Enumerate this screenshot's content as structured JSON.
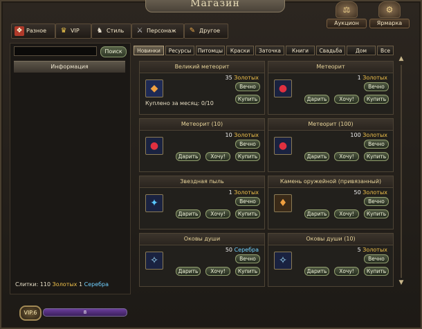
{
  "window": {
    "title": "Магазин"
  },
  "top_buttons": {
    "auction": "Аукцион",
    "fair": "Ярмарка"
  },
  "categories": [
    {
      "label": "Разное",
      "icon": "gift-icon"
    },
    {
      "label": "VIP",
      "icon": "crown-icon"
    },
    {
      "label": "Стиль",
      "icon": "costume-icon"
    },
    {
      "label": "Персонаж",
      "icon": "sword-icon"
    },
    {
      "label": "Другое",
      "icon": "torch-icon"
    }
  ],
  "search": {
    "value": "",
    "button": "Поиск"
  },
  "info_header": "Информация",
  "balance": {
    "label": "Слитки:",
    "gold_amount": "110",
    "gold_unit": "Золотых",
    "silver_amount": "1",
    "silver_unit": "Серебра"
  },
  "tabs": [
    "Новинки",
    "Ресурсы",
    "Питомцы",
    "Краски",
    "Заточка",
    "Книги",
    "Свадьба",
    "Дом",
    "Все"
  ],
  "active_tab": "Новинки",
  "buttons": {
    "forever": "Вечно",
    "buy": "Купить",
    "gift": "Дарить",
    "want": "Хочу!"
  },
  "cards": [
    {
      "title": "Великий метеорит",
      "price": "35",
      "currency": "Золотых",
      "bought": "Куплено за месяц: 0/10"
    },
    {
      "title": "Метеорит",
      "price": "1",
      "currency": "Золотых"
    },
    {
      "title": "Метеорит (10)",
      "price": "10",
      "currency": "Золотых"
    },
    {
      "title": "Метеорит (100)",
      "price": "100",
      "currency": "Золотых"
    },
    {
      "title": "Звездная пыль",
      "price": "1",
      "currency": "Золотых"
    },
    {
      "title": "Камень оружейной (привязанный)",
      "price": "50",
      "currency": "Золотых"
    },
    {
      "title": "Оковы души",
      "price": "50",
      "currency": "Серебра"
    },
    {
      "title": "Оковы души (10)",
      "price": "5",
      "currency": "Золотых"
    }
  ],
  "vip": {
    "label": "VIP.6",
    "level": "8"
  },
  "colors": {
    "gold": "#f0c14a",
    "silver": "#6fd0ff",
    "title_text": "#e8d49a"
  }
}
